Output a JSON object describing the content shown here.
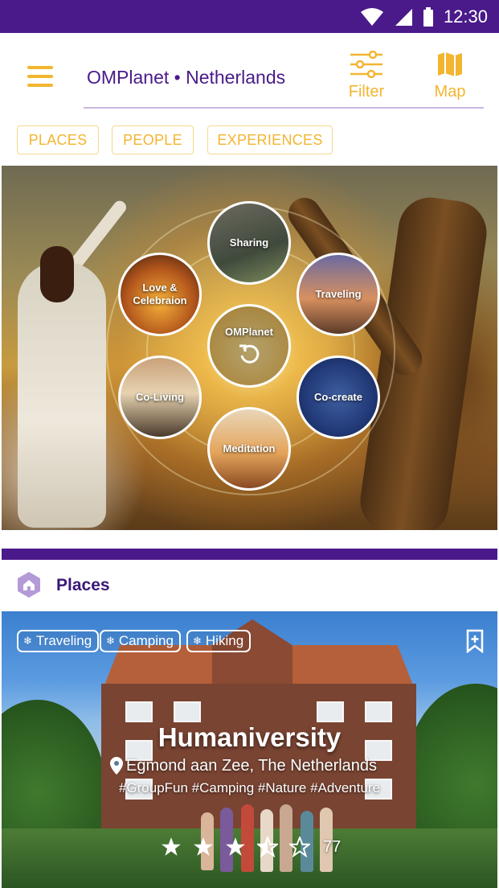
{
  "status_bar": {
    "time": "12:30"
  },
  "toolbar": {
    "title": "OMPlanet • Netherlands",
    "filter_label": "Filter",
    "map_label": "Map"
  },
  "chips": [
    "PLACES",
    "PEOPLE",
    "EXPERIENCES"
  ],
  "hero": {
    "center": "OMPlanet",
    "bubbles": {
      "sharing": "Sharing",
      "love": "Love &",
      "love2": "Celebraion",
      "traveling": "Traveling",
      "coliving": "Co-Living",
      "cocreate": "Co-create",
      "meditation": "Meditation"
    }
  },
  "section": {
    "title": "Places"
  },
  "card": {
    "tags": [
      "Traveling",
      "Camping",
      "Hiking"
    ],
    "title": "Humaniversity",
    "location": "Egmond aan Zee, The Netherlands",
    "hashtags": "#GroupFun #Camping #Nature #Adventure",
    "rating": 3.5,
    "rating_count": "77"
  },
  "colors": {
    "primary": "#4a1a8a",
    "accent": "#f3b530"
  }
}
